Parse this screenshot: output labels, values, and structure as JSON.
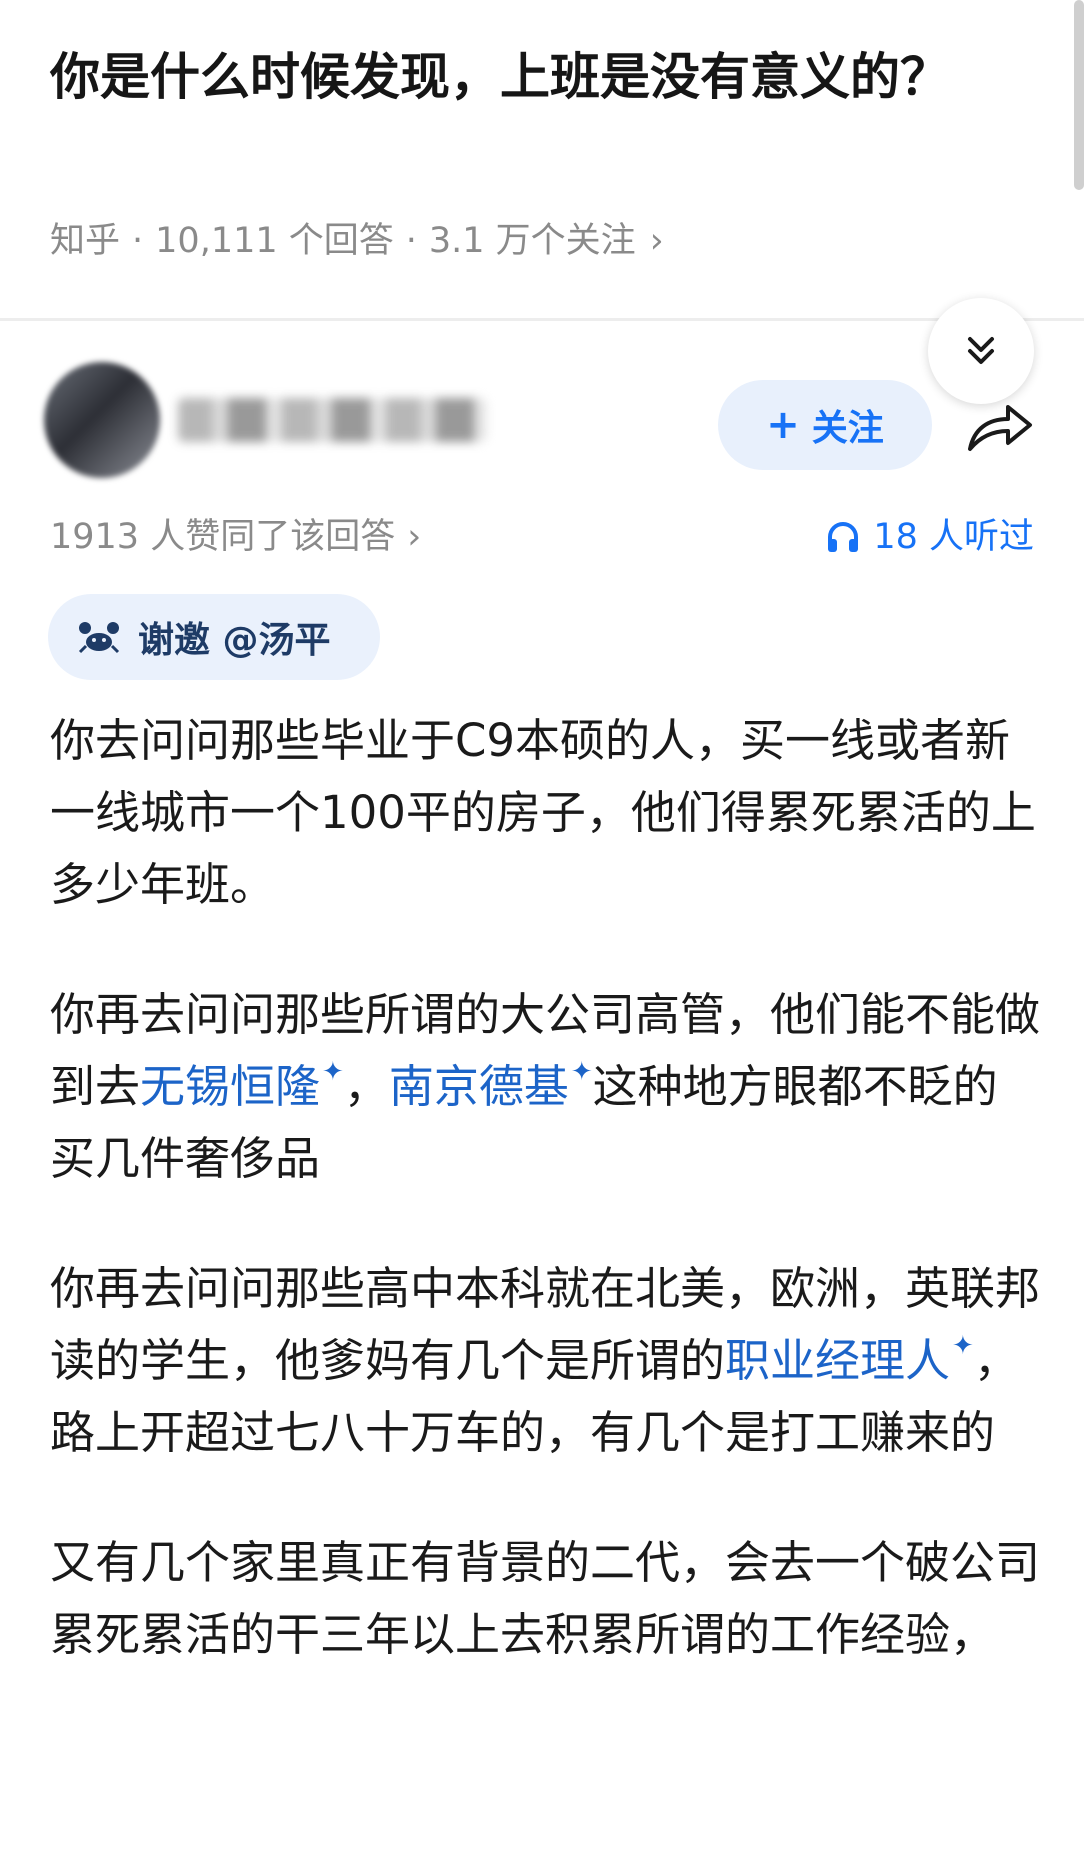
{
  "question": {
    "title": "你是什么时候发现，上班是没有意义的？",
    "site": "知乎",
    "answers": "10,111 个回答",
    "followers": "3.1 万个关注",
    "chevron": "›"
  },
  "answer": {
    "follow_label": "关注",
    "follow_plus": "+",
    "likes": "1913 人赞同了该回答",
    "likes_chevron": "›",
    "listens": "18 人听过",
    "invite": "谢邀 @汤平",
    "paragraphs": [
      {
        "t1": "你去问问那些毕业于C9本硕的人，买一线或者新一线城市一个100平的房子，他们得累死累活的上多少年班。"
      },
      {
        "t1": "你再去问问那些所谓的大公司高管，他们能不能做到去",
        "link1": "无锡恒隆",
        "t2": "，",
        "link2": "南京德基",
        "t3": "这种地方眼都不眨的买几件奢侈品"
      },
      {
        "t1": "你再去问问那些高中本科就在北美，欧洲，英联邦读的学生，他爹妈有几个是所谓的",
        "link1": "职业经理人",
        "t2": "，路上开超过七八十万车的，有几个是打工赚来的"
      },
      {
        "t1": "又有几个家里真正有背景的二代，会去一个破公司累死累活的干三年以上去积累所谓的工作经验，"
      }
    ],
    "link_marker": "✦"
  },
  "colors": {
    "accent": "#1772f6",
    "link": "#1c64c8",
    "meta_gray": "#8a8a8a",
    "chip_bg": "#eaf1fc"
  },
  "icons": [
    "chevrons-down-icon",
    "share-icon",
    "headphones-icon",
    "crab-icon"
  ]
}
